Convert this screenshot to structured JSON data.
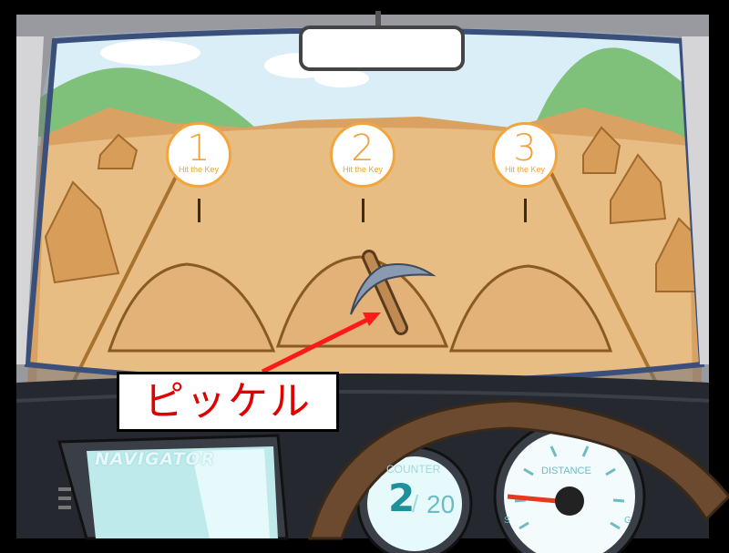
{
  "keys": [
    {
      "number": "1",
      "hint": "Hit the Key"
    },
    {
      "number": "2",
      "hint": "Hit the Key"
    },
    {
      "number": "3",
      "hint": "Hit the Key"
    }
  ],
  "annotation": {
    "label": "ピッケル",
    "color": "#e00000"
  },
  "tool": {
    "icon": "pickaxe-icon",
    "position": "2"
  },
  "dashboard": {
    "navigator_title": "NAVIGATOR",
    "counter": {
      "label": "COUNTER",
      "current": "2",
      "separator": "/",
      "total": "20"
    },
    "distance": {
      "label": "DISTANCE",
      "start": "S",
      "goal": "G",
      "progress": 0.05
    }
  },
  "colors": {
    "accent": "#f0a23a",
    "dirt": "#e6b77c",
    "sky": "#d9f0f6",
    "gauge": "#6dbcc4"
  }
}
